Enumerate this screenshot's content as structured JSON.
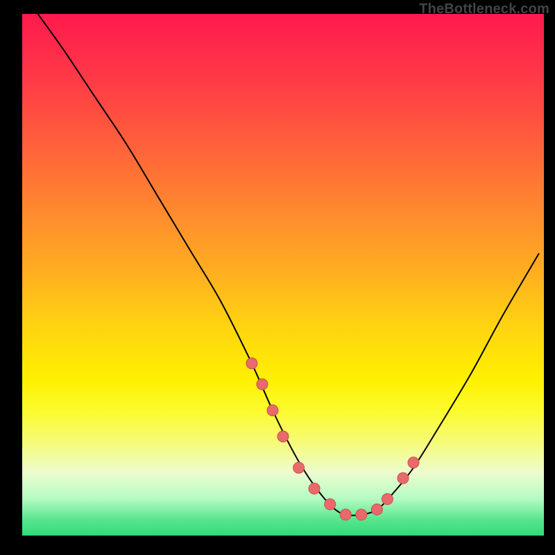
{
  "watermark": {
    "text": "TheBottleneck.com"
  },
  "chart_data": {
    "type": "line",
    "title": "",
    "xlabel": "",
    "ylabel": "",
    "xlim": [
      0,
      100
    ],
    "ylim": [
      0,
      100
    ],
    "grid": false,
    "series": [
      {
        "name": "curve",
        "x": [
          3,
          8,
          14,
          20,
          26,
          32,
          38,
          44,
          48,
          52,
          55,
          58,
          60,
          62,
          65,
          68,
          71,
          75,
          80,
          86,
          92,
          99
        ],
        "y": [
          100,
          93,
          84,
          75,
          65,
          55,
          45,
          33,
          24,
          16,
          11,
          7,
          5,
          4,
          4,
          5,
          8,
          13,
          21,
          31,
          42,
          54
        ]
      }
    ],
    "markers": {
      "name": "highlight-points",
      "x": [
        44,
        46,
        48,
        50,
        53,
        56,
        59,
        62,
        65,
        68,
        70,
        73,
        75
      ],
      "y": [
        33,
        29,
        24,
        19,
        13,
        9,
        6,
        4,
        4,
        5,
        7,
        11,
        14
      ]
    },
    "colors": {
      "curve": "#000000",
      "marker_fill": "#e86a6a",
      "marker_stroke": "#c94f4f"
    }
  }
}
